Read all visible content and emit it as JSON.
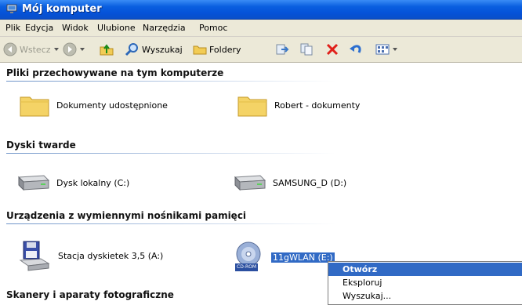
{
  "window": {
    "title": "Mój komputer"
  },
  "menubar": {
    "items": [
      "Plik",
      "Edycja",
      "Widok",
      "Ulubione",
      "Narzędzia",
      "Pomoc"
    ]
  },
  "toolbar": {
    "back_label": "Wstecz",
    "search_label": "Wyszukaj",
    "folders_label": "Foldery"
  },
  "sections": [
    {
      "title": "Pliki przechowywane na tym komputerze",
      "items": [
        {
          "label": "Dokumenty udostępnione",
          "icon": "folder-icon"
        },
        {
          "label": "Robert - dokumenty",
          "icon": "folder-icon"
        }
      ]
    },
    {
      "title": "Dyski twarde",
      "items": [
        {
          "label": "Dysk lokalny (C:)",
          "icon": "hard-drive-icon"
        },
        {
          "label": "SAMSUNG_D (D:)",
          "icon": "hard-drive-icon"
        }
      ]
    },
    {
      "title": "Urządzenia z wymiennymi nośnikami pamięci",
      "items": [
        {
          "label": "Stacja dyskietek 3,5 (A:)",
          "icon": "floppy-drive-icon"
        },
        {
          "label": "11gWLAN (E:)",
          "icon": "cd-rom-icon",
          "badge": "CD-ROM"
        }
      ]
    },
    {
      "title": "Skanery i aparaty fotograficzne",
      "items": []
    }
  ],
  "context_menu": {
    "items": [
      "Otwórz",
      "Eksploruj",
      "Wyszukaj..."
    ]
  },
  "colors": {
    "title_bar": "#0552d8",
    "selection": "#316ac5",
    "toolbar_bg": "#ece9d8"
  }
}
